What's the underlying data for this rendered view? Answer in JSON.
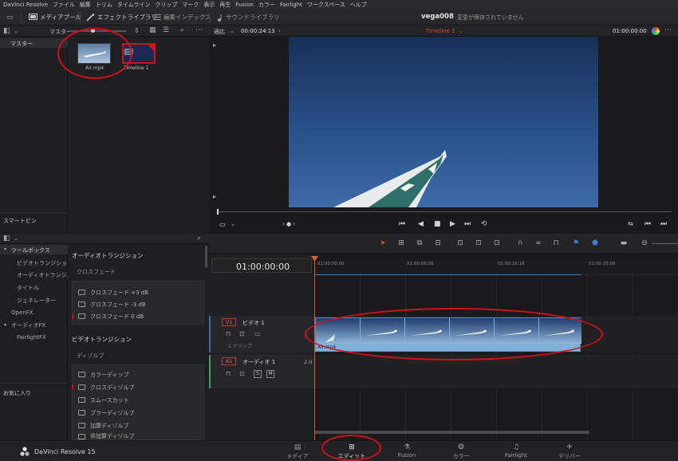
{
  "menu": [
    "DaVinci Resolve",
    "ファイル",
    "編集",
    "トリム",
    "タイムライン",
    "クリップ",
    "マーク",
    "表示",
    "再生",
    "Fusion",
    "カラー",
    "Fairlight",
    "ワークスペース",
    "ヘルプ"
  ],
  "toolbar": {
    "media_pool": "メディアプール",
    "effects_library": "エフェクトライブラリ",
    "edit_index": "編集インデックス",
    "sound_library": "サウンドライブラリ",
    "project_name": "vega008",
    "unsaved": "変更が保存されていません"
  },
  "media_pool": {
    "header": "マスター",
    "bins": [
      "マスター"
    ],
    "smart_bins_label": "スマートビン",
    "clips": [
      {
        "name": "Air.mp4",
        "type": "video"
      },
      {
        "name": "Timeline 1",
        "type": "timeline"
      }
    ]
  },
  "viewer": {
    "zoom": "適応",
    "timecode": "00:00:24:13",
    "timeline_name": "Timeline 1",
    "record_timecode": "01:00:00:00"
  },
  "effects": {
    "tree": [
      {
        "label": "ツールボックス",
        "level": 0,
        "expanded": true
      },
      {
        "label": "ビデオトランジション",
        "level": 1
      },
      {
        "label": "オーディオトランジ...",
        "level": 1
      },
      {
        "label": "タイトル",
        "level": 1
      },
      {
        "label": "ジェネレーター",
        "level": 1
      },
      {
        "label": "OpenFX",
        "level": 0
      },
      {
        "label": "オーディオFX",
        "level": 0,
        "expanded": true
      },
      {
        "label": "FairlightFX",
        "level": 1
      }
    ],
    "favorites_label": "お気に入り",
    "audio_section": "オーディオトランジション",
    "crossfade_group": "クロスフェード",
    "audio_items": [
      "クロスフェード +3 dB",
      "クロスフェード -3 dB",
      "クロスフェード 0 dB"
    ],
    "video_section": "ビデオトランジション",
    "dissolve_group": "ディゾルブ",
    "video_items": [
      "カラーディップ",
      "クロスディゾルブ",
      "スムースカット",
      "ブラーディゾルブ",
      "加算ディゾルブ",
      "非加算ディゾルブ"
    ]
  },
  "timeline": {
    "timecode": "01:00:00:00",
    "ruler": [
      "01:00:00:00",
      "01:00:08:08",
      "01:00:16:16",
      "01:00:25:00"
    ],
    "video_track": {
      "id": "V1",
      "name": "ビデオ 1",
      "clip_count": "1 クリップ"
    },
    "audio_track": {
      "id": "A1",
      "name": "オーディオ 1",
      "channels": "2.0",
      "buttons": [
        "S",
        "M"
      ]
    },
    "clip_name": "Air.mp4"
  },
  "pages": [
    "メディア",
    "エディット",
    "Fusion",
    "カラー",
    "Fairlight",
    "デリバー"
  ],
  "active_page": "エディット",
  "app_name": "DaVinci Resolve 15",
  "colors": {
    "accent_red": "#d0101b",
    "playhead": "#e05a2b",
    "clip_audio": "#7fb0d8"
  }
}
